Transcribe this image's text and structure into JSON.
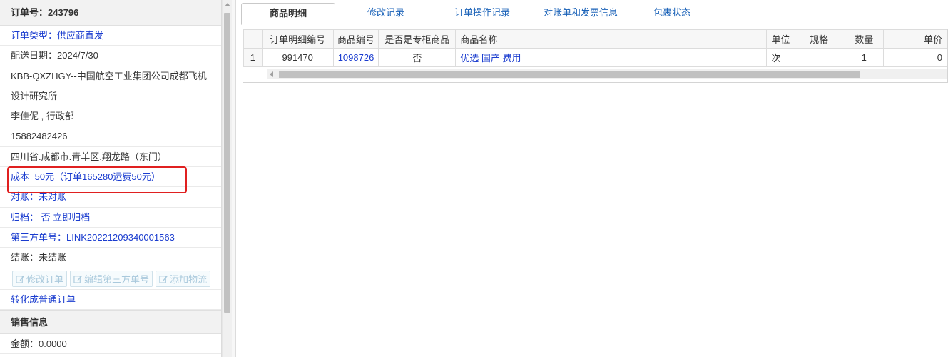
{
  "order": {
    "number_label": "订单号：",
    "number": "243796",
    "type": "订单类型：供应商直发",
    "delivery_date": "配送日期：2024/7/30",
    "customer_line1": "KBB-QXZHGY--中国航空工业集团公司成都飞机",
    "customer_line2": "设计研究所",
    "contact": "李佳伲 , 行政部",
    "phone": "15882482426",
    "address": "四川省.成都市.青羊区.翔龙路（东门）",
    "cost": "成本=50元（订单165280运费50元）",
    "reconcile": "对账：未对账",
    "archive_label": "归档：",
    "archive_value": "否",
    "archive_action": "立即归档",
    "third_party_no": "第三方单号：LINK20221209340001563",
    "settlement": "结账：未结账",
    "buttons": {
      "edit_order": "修改订单",
      "edit_third_party": "编辑第三方单号",
      "add_logistics": "添加物流"
    },
    "convert": "转化成普通订单",
    "sales_section": "销售信息",
    "amount": "金额：0.0000"
  },
  "tabs": [
    {
      "label": "商品明细",
      "active": true
    },
    {
      "label": "修改记录",
      "active": false
    },
    {
      "label": "订单操作记录",
      "active": false
    },
    {
      "label": "对账单和发票信息",
      "active": false
    },
    {
      "label": "包裹状态",
      "active": false
    }
  ],
  "grid": {
    "columns": [
      "订单明细编号",
      "商品编号",
      "是否是专柜商品",
      "商品名称",
      "单位",
      "规格",
      "数量",
      "单价"
    ],
    "rows": [
      {
        "index": "1",
        "detail_no": "991470",
        "product_no": "1098726",
        "counter": "否",
        "name": "优选 国产 费用",
        "unit": "次",
        "spec": "",
        "qty": "1",
        "price": "0"
      }
    ]
  },
  "colors": {
    "link": "#1a3ccf",
    "highlight_box": "#e02020",
    "tab_text": "#1a62b8"
  }
}
